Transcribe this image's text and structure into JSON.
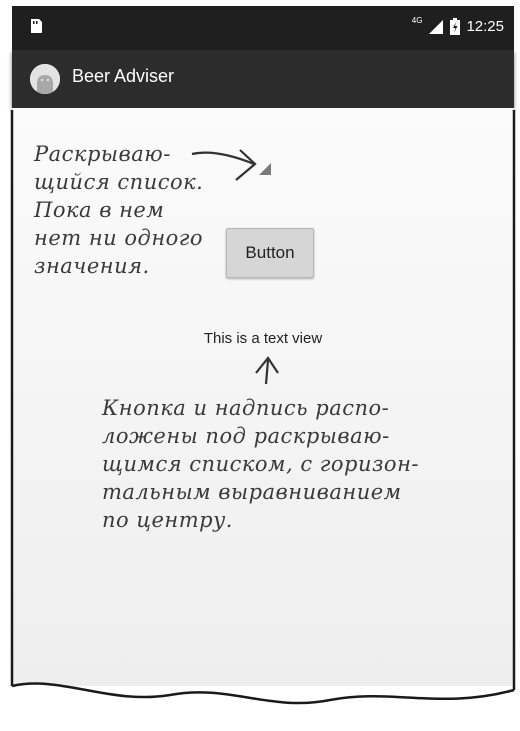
{
  "status_bar": {
    "network": "4G",
    "time": "12:25"
  },
  "app_bar": {
    "title": "Beer Adviser"
  },
  "main": {
    "button_label": "Button",
    "text_view": "This is a text view"
  },
  "annotations": {
    "spinner_note": [
      "Раскрываю-",
      "щийся список.",
      "Пока в нем",
      "нет ни одного",
      "значения."
    ],
    "layout_note": [
      "Кнопка и надпись распо-",
      "ложены под раскрываю-",
      "щимся списком, с горизон-",
      "тальным выравниванием",
      "по центру."
    ]
  },
  "colors": {
    "status_bar": "#1f1f1f",
    "app_bar": "#2c2c2c",
    "button": "#d6d6d6",
    "annotation_ink": "#3a3a3a"
  }
}
